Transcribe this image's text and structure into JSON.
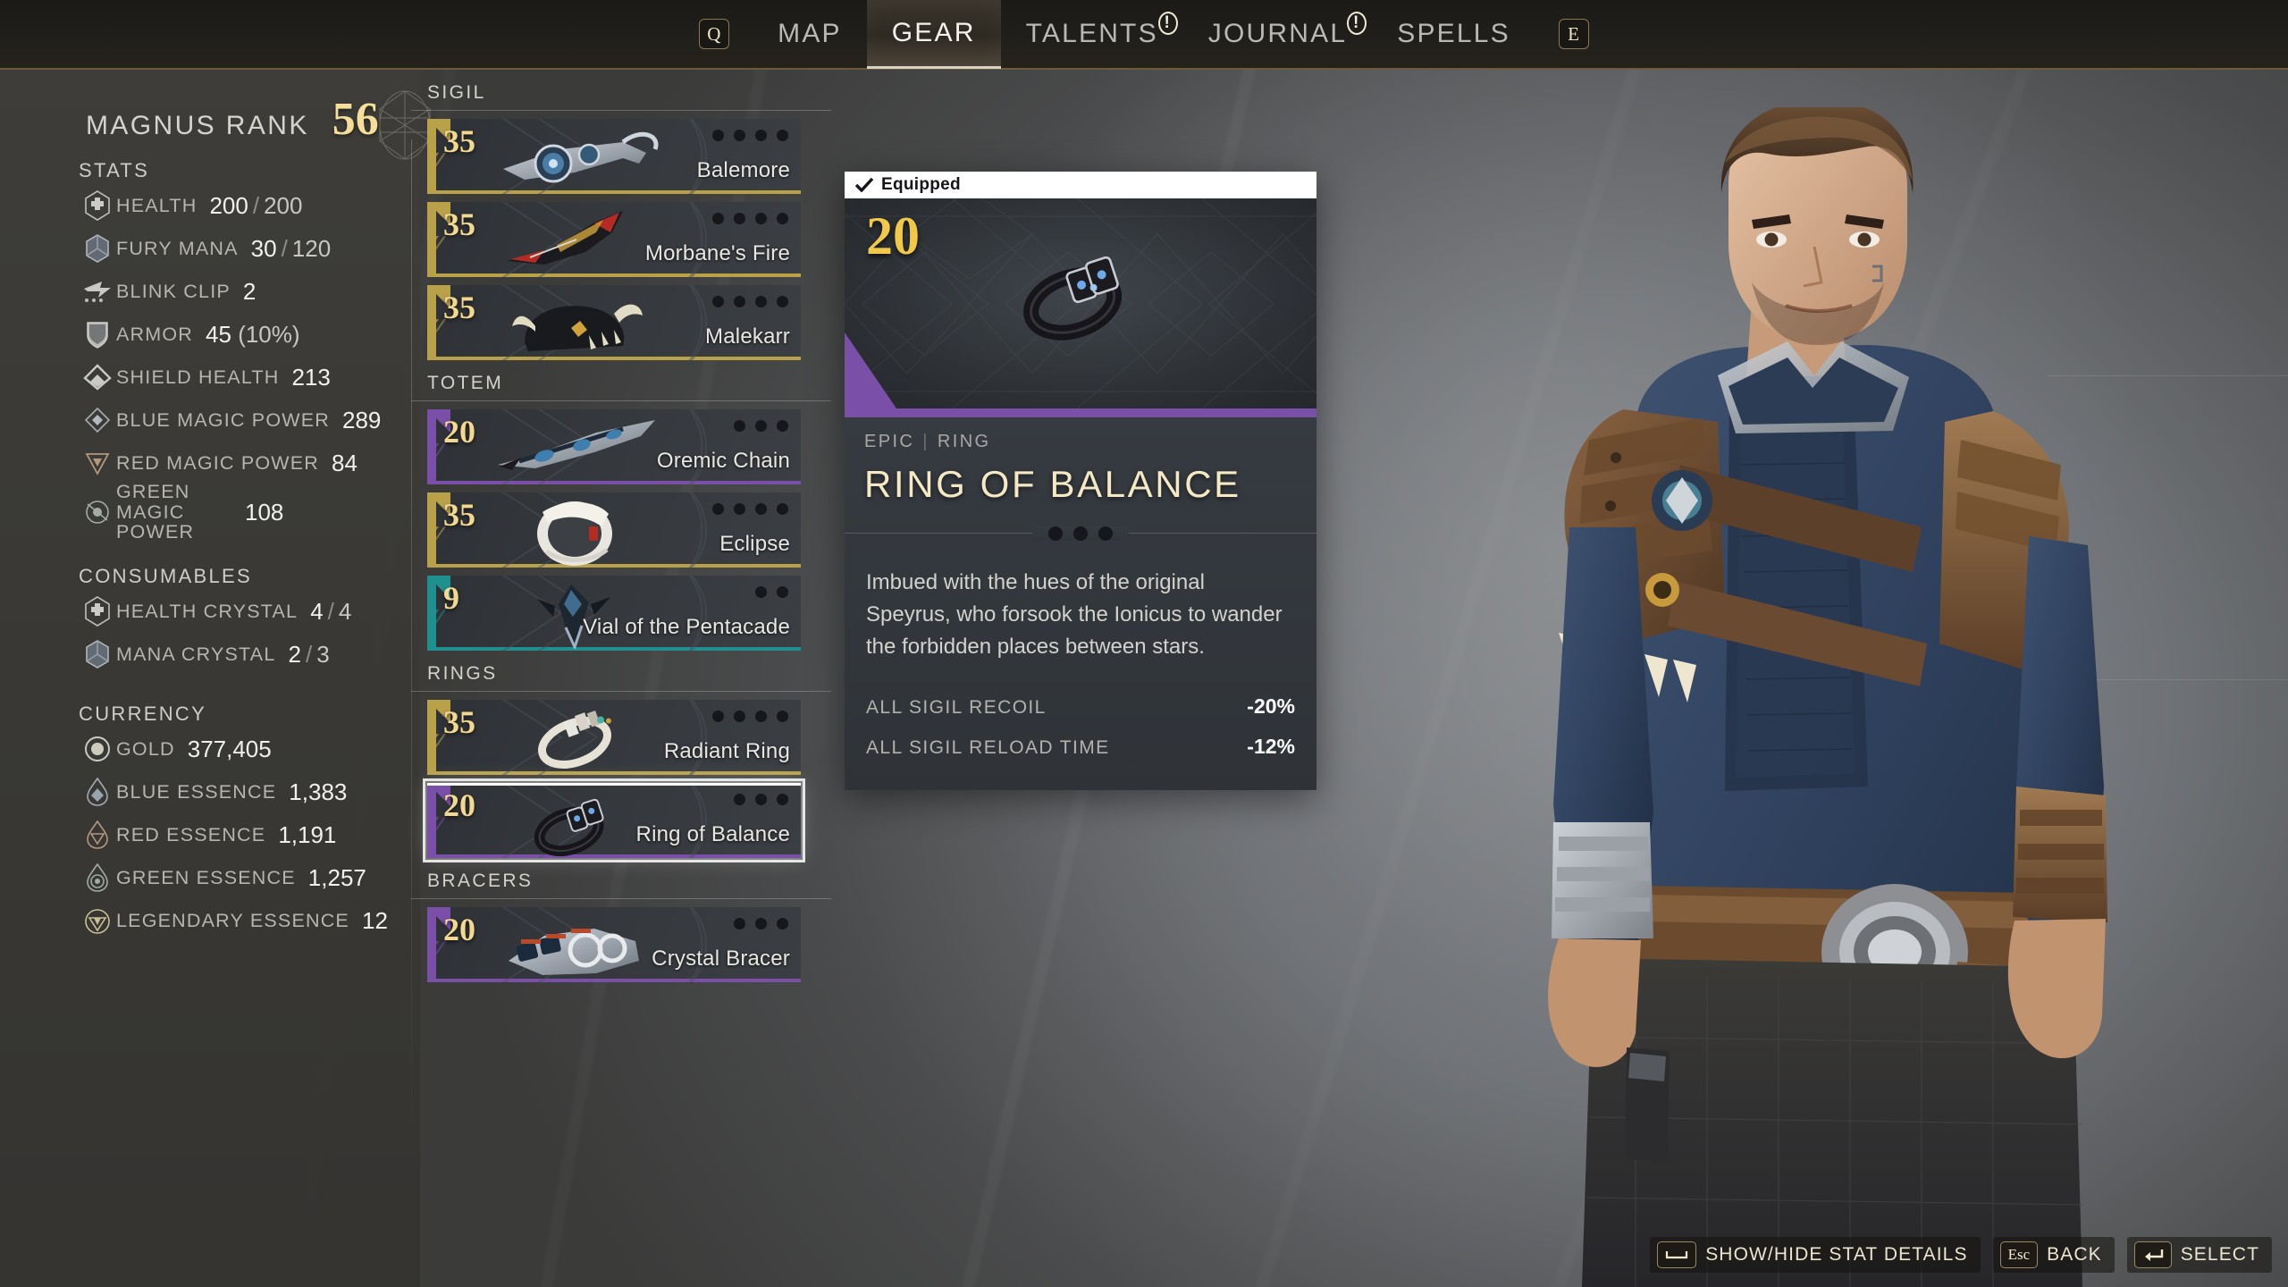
{
  "nav": {
    "left_key": "Q",
    "right_key": "E",
    "items": [
      {
        "label": "MAP",
        "active": false,
        "badge": ""
      },
      {
        "label": "GEAR",
        "active": true,
        "badge": ""
      },
      {
        "label": "TALENTS",
        "active": false,
        "badge": "!"
      },
      {
        "label": "JOURNAL",
        "active": false,
        "badge": "!"
      },
      {
        "label": "SPELLS",
        "active": false,
        "badge": ""
      }
    ]
  },
  "sidebar": {
    "rank_label": "MAGNUS RANK",
    "rank_value": "56",
    "stats_title": "STATS",
    "stats": [
      {
        "icon": "health-icon",
        "label": "HEALTH",
        "value": "200",
        "sep": "/",
        "value2": "200",
        "extra": ""
      },
      {
        "icon": "mana-icon",
        "label": "FURY MANA",
        "value": "30",
        "sep": "/",
        "value2": "120",
        "extra": ""
      },
      {
        "icon": "blink-icon",
        "label": "BLINK CLIP",
        "value": "2",
        "sep": "",
        "value2": "",
        "extra": ""
      },
      {
        "icon": "shield-icon",
        "label": "ARMOR",
        "value": "45",
        "sep": "",
        "value2": "",
        "extra": "(10%)"
      },
      {
        "icon": "chevron-icon",
        "label": "SHIELD HEALTH",
        "value": "213",
        "sep": "",
        "value2": "",
        "extra": ""
      },
      {
        "icon": "blue-magic-icon",
        "label": "BLUE MAGIC POWER",
        "value": "289",
        "sep": "",
        "value2": "",
        "extra": ""
      },
      {
        "icon": "red-magic-icon",
        "label": "RED MAGIC POWER",
        "value": "84",
        "sep": "",
        "value2": "",
        "extra": ""
      },
      {
        "icon": "green-magic-icon",
        "label": "GREEN MAGIC POWER",
        "value": "108",
        "sep": "",
        "value2": "",
        "extra": ""
      }
    ],
    "consumables_title": "CONSUMABLES",
    "consumables": [
      {
        "icon": "health-crystal-icon",
        "label": "HEALTH CRYSTAL",
        "value": "4",
        "sep": "/",
        "value2": "4"
      },
      {
        "icon": "mana-crystal-icon",
        "label": "MANA CRYSTAL",
        "value": "2",
        "sep": "/",
        "value2": "3"
      }
    ],
    "currency_title": "CURRENCY",
    "currency": [
      {
        "icon": "gold-icon",
        "label": "GOLD",
        "value": "377,405"
      },
      {
        "icon": "blue-essence-icon",
        "label": "BLUE ESSENCE",
        "value": "1,383"
      },
      {
        "icon": "red-essence-icon",
        "label": "RED ESSENCE",
        "value": "1,191"
      },
      {
        "icon": "green-essence-icon",
        "label": "GREEN ESSENCE",
        "value": "1,257"
      },
      {
        "icon": "legendary-essence-icon",
        "label": "LEGENDARY ESSENCE",
        "value": "12"
      }
    ]
  },
  "gear": {
    "groups": [
      {
        "label": "SIGIL",
        "items": [
          {
            "level": "35",
            "name": "Balemore",
            "rarity": "legendary",
            "rarity_color": "#b9a14a",
            "dots": 4,
            "selected": false,
            "art": "sigil-balemore"
          },
          {
            "level": "35",
            "name": "Morbane's Fire",
            "rarity": "legendary",
            "rarity_color": "#b9a14a",
            "dots": 4,
            "selected": false,
            "art": "sigil-morbane"
          },
          {
            "level": "35",
            "name": "Malekarr",
            "rarity": "legendary",
            "rarity_color": "#b9a14a",
            "dots": 4,
            "selected": false,
            "art": "sigil-malekarr"
          }
        ]
      },
      {
        "label": "TOTEM",
        "items": [
          {
            "level": "20",
            "name": "Oremic Chain",
            "rarity": "epic",
            "rarity_color": "#7a4fa8",
            "dots": 3,
            "selected": false,
            "art": "totem-oremic"
          },
          {
            "level": "35",
            "name": "Eclipse",
            "rarity": "legendary",
            "rarity_color": "#b9a14a",
            "dots": 4,
            "selected": false,
            "art": "totem-eclipse"
          },
          {
            "level": "9",
            "name": "Vial of the Pentacade",
            "rarity": "rare",
            "rarity_color": "#1f8f8f",
            "dots": 2,
            "selected": false,
            "art": "totem-vial"
          }
        ]
      },
      {
        "label": "RINGS",
        "items": [
          {
            "level": "35",
            "name": "Radiant Ring",
            "rarity": "legendary",
            "rarity_color": "#b9a14a",
            "dots": 4,
            "selected": false,
            "art": "ring-radiant"
          },
          {
            "level": "20",
            "name": "Ring of Balance",
            "rarity": "epic",
            "rarity_color": "#7a4fa8",
            "dots": 3,
            "selected": true,
            "art": "ring-balance"
          }
        ]
      },
      {
        "label": "BRACERS",
        "items": [
          {
            "level": "20",
            "name": "Crystal Bracer",
            "rarity": "epic",
            "rarity_color": "#7a4fa8",
            "dots": 3,
            "selected": false,
            "art": "bracer-crystal"
          }
        ]
      }
    ]
  },
  "detail": {
    "equipped_label": "Equipped",
    "level": "20",
    "rarity": "EPIC",
    "slot": "RING",
    "rarity_color": "#7a4fa8",
    "title": "RING OF BALANCE",
    "dots": 3,
    "description": "Imbued with the hues of the original Speyrus, who forsook the Ionicus to wander the forbidden places between stars.",
    "stats": [
      {
        "name": "ALL SIGIL RECOIL",
        "value": "-20%"
      },
      {
        "name": "ALL SIGIL RELOAD TIME",
        "value": "-12%"
      }
    ]
  },
  "hints": [
    {
      "key": "space-bar-icon",
      "key_text": "",
      "label": "SHOW/HIDE STAT DETAILS"
    },
    {
      "key": "esc-key",
      "key_text": "Esc",
      "label": "BACK"
    },
    {
      "key": "enter-key-icon",
      "key_text": "",
      "label": "SELECT"
    }
  ],
  "colors": {
    "accent_gold": "#f5dd9a",
    "legendary": "#b9a14a",
    "epic": "#7a4fa8",
    "rare": "#1f8f8f",
    "nav_border": "#6b5a3c"
  }
}
